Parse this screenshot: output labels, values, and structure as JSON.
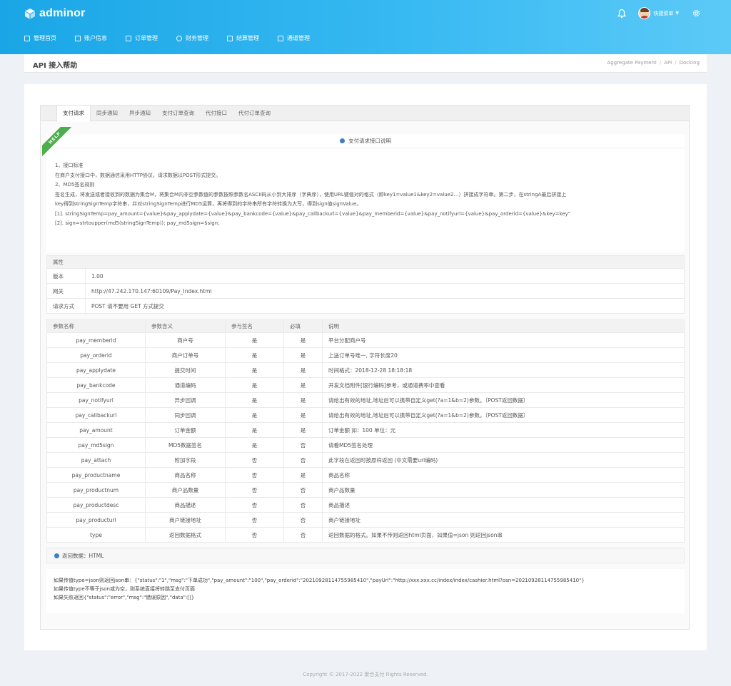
{
  "header": {
    "brand": "adminor",
    "user": "快捷菜单",
    "nav": [
      "管理首页",
      "账户信息",
      "订单管理",
      "财务管理",
      "结算管理",
      "通道管理"
    ]
  },
  "breadcrumb": {
    "title": "API 接入帮助",
    "items": [
      "Aggregate Payment",
      "API",
      "Docking"
    ]
  },
  "tabs": [
    "支付请求",
    "同步通知",
    "异步通知",
    "支付订单查询",
    "代付接口",
    "代付订单查询"
  ],
  "help_badge": "HELP",
  "section_title": "支付请求接口说明",
  "description": [
    "1、接口标准",
    "在商户支付接口中，数据通信采用HTTP协议，请求数据以POST形式提交。",
    "2、MD5签名规则",
    "签名生成，将发送或者接收到的数据为集合M，将集合M内非空参数值的参数按照参数名ASCII码从小到大排序（字典序），使用URL键值对的格式（即key1=value1&key2=value2…）拼接成字符串。第二步，在stringA最后拼接上",
    "key得到stringSignTemp字符串，并对stringSignTemp进行MD5运算，再将得到的字符串所有字符转换为大写，得到sign值signValue。",
    "[1]. stringSignTemp=pay_amount={value}&pay_applydate={value}&pay_bankcode={value}&pay_callbackurl={value}&pay_memberid={value}&pay_notifyurl={value}&pay_orderid={value}&key=key\"",
    "[2]. sign=strtoupper(md5(stringSignTemp)); pay_md5sign=$sign;"
  ],
  "properties": {
    "header": "属性",
    "rows": [
      {
        "key": "版本",
        "value": "1.00"
      },
      {
        "key": "网关",
        "value": "http://47.242.170.147:60109/Pay_Index.html"
      },
      {
        "key": "请求方式",
        "value": "POST 请不要用 GET 方式提交"
      }
    ]
  },
  "params": {
    "headers": [
      "参数名称",
      "参数含义",
      "参与签名",
      "必填",
      "说明"
    ],
    "rows": [
      [
        "pay_memberid",
        "商户号",
        "是",
        "是",
        "平台分配商户号"
      ],
      [
        "pay_orderid",
        "商户订单号",
        "是",
        "是",
        "上送订单号唯一, 字符长度20"
      ],
      [
        "pay_applydate",
        "提交时间",
        "是",
        "是",
        "时间格式：2018-12-28 18:18:18"
      ],
      [
        "pay_bankcode",
        "通道编码",
        "是",
        "是",
        "开发文档附件[银行编码]参考，或通道费率中查看"
      ],
      [
        "pay_notifyurl",
        "异步回调",
        "是",
        "是",
        "请给出有效的地址,地址后可以携带自定义get(?a=1&b=2)参数。（POST返回数据）"
      ],
      [
        "pay_callbackurl",
        "同步回调",
        "是",
        "是",
        "请给出有效的地址,地址后可以携带自定义get(?a=1&b=2)参数。（POST返回数据）"
      ],
      [
        "pay_amount",
        "订单金额",
        "是",
        "是",
        "订单金额 如：100 单位：元"
      ],
      [
        "pay_md5sign",
        "MD5数据签名",
        "是",
        "否",
        "请看MD5签名处理"
      ],
      [
        "pay_attach",
        "附加字段",
        "否",
        "否",
        "此字段在返回时按原样返回 (中文需要url编码)"
      ],
      [
        "pay_productname",
        "商品名称",
        "否",
        "是",
        "商品名称"
      ],
      [
        "pay_productnum",
        "商户品数量",
        "否",
        "否",
        "商户品数量"
      ],
      [
        "pay_productdesc",
        "商品描述",
        "否",
        "否",
        "商品描述"
      ],
      [
        "pay_producturl",
        "商户链接地址",
        "否",
        "否",
        "商户链接地址"
      ],
      [
        "type",
        "返回数据格式",
        "否",
        "否",
        "返回数据的格式。如果不传则返回html页面，如果值=json 则返回json串"
      ]
    ]
  },
  "return": {
    "title": "返回数据：HTML",
    "lines": [
      "如果传值type=json则返回json串：{\"status\":\"1\",\"msg\":\"下单成功\",\"pay_amount\":\"100\",\"pay_orderid\":\"20210928114755985410\",\"payUrl\":\"http://xxx.xxx.cc/index/index/cashier.html?osn=20210928114755985410\"}",
      "如果传值type不等于json或为空，则系统直接将转跳至支付页面",
      "如果失败返回{\"status\":\"error\",\"msg\":\"错误原因\",\"data\":[]}"
    ]
  },
  "footer": "Copyright © 2017-2022 聚合支付 Rights Reserved.",
  "colors": {
    "header_start": "#1aa6e6",
    "header_end": "#5ccaf7",
    "help_green": "#4cae4c",
    "info_blue": "#3c7fc8"
  }
}
